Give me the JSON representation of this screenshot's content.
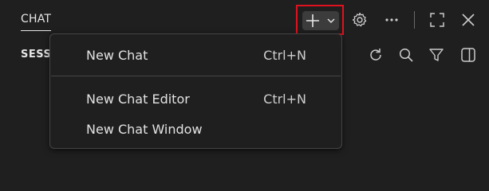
{
  "header": {
    "title": "CHAT",
    "new_chat_button_icon": "plus-icon",
    "new_chat_dropdown_icon": "chevron-down-icon",
    "highlight_color": "#e0121f",
    "icons": [
      "gear-icon",
      "more-icon",
      "maximize-icon",
      "close-icon"
    ]
  },
  "sessions": {
    "label": "SESS",
    "toolbar_icons": [
      "refresh-icon",
      "search-icon",
      "filter-icon",
      "split-view-icon"
    ]
  },
  "menu": {
    "items": [
      {
        "label": "New Chat",
        "shortcut": "Ctrl+N"
      },
      {
        "label": "New Chat Editor",
        "shortcut": "Ctrl+N"
      },
      {
        "label": "New Chat Window",
        "shortcut": ""
      }
    ]
  }
}
